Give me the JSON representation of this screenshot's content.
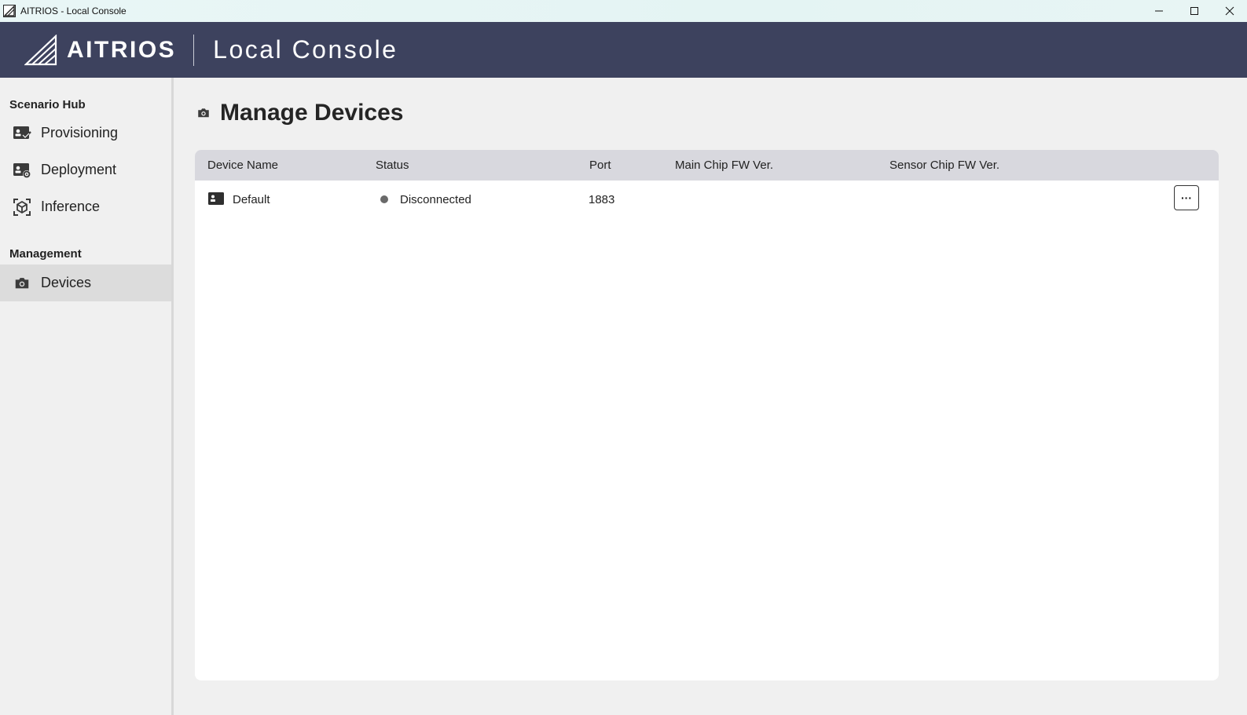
{
  "window": {
    "title": "AITRIOS - Local Console"
  },
  "header": {
    "brand": "AITRIOS",
    "product": "Local Console"
  },
  "sidebar": {
    "sections": [
      {
        "label": "Scenario Hub"
      },
      {
        "label": "Management"
      }
    ],
    "items": [
      {
        "label": "Provisioning",
        "icon": "provisioning-icon"
      },
      {
        "label": "Deployment",
        "icon": "deployment-icon"
      },
      {
        "label": "Inference",
        "icon": "inference-icon"
      },
      {
        "label": "Devices",
        "icon": "camera-icon",
        "active": true
      }
    ]
  },
  "main": {
    "title": "Manage Devices",
    "table": {
      "columns": [
        "Device Name",
        "Status",
        "Port",
        "Main Chip FW Ver.",
        "Sensor Chip FW Ver."
      ],
      "rows": [
        {
          "name": "Default",
          "status": "Disconnected",
          "port": "1883",
          "main_fw": "",
          "sensor_fw": ""
        }
      ]
    },
    "more_label": "···"
  },
  "colors": {
    "header_bg": "#3d425e",
    "status_disconnected": "#6a6a6a"
  }
}
